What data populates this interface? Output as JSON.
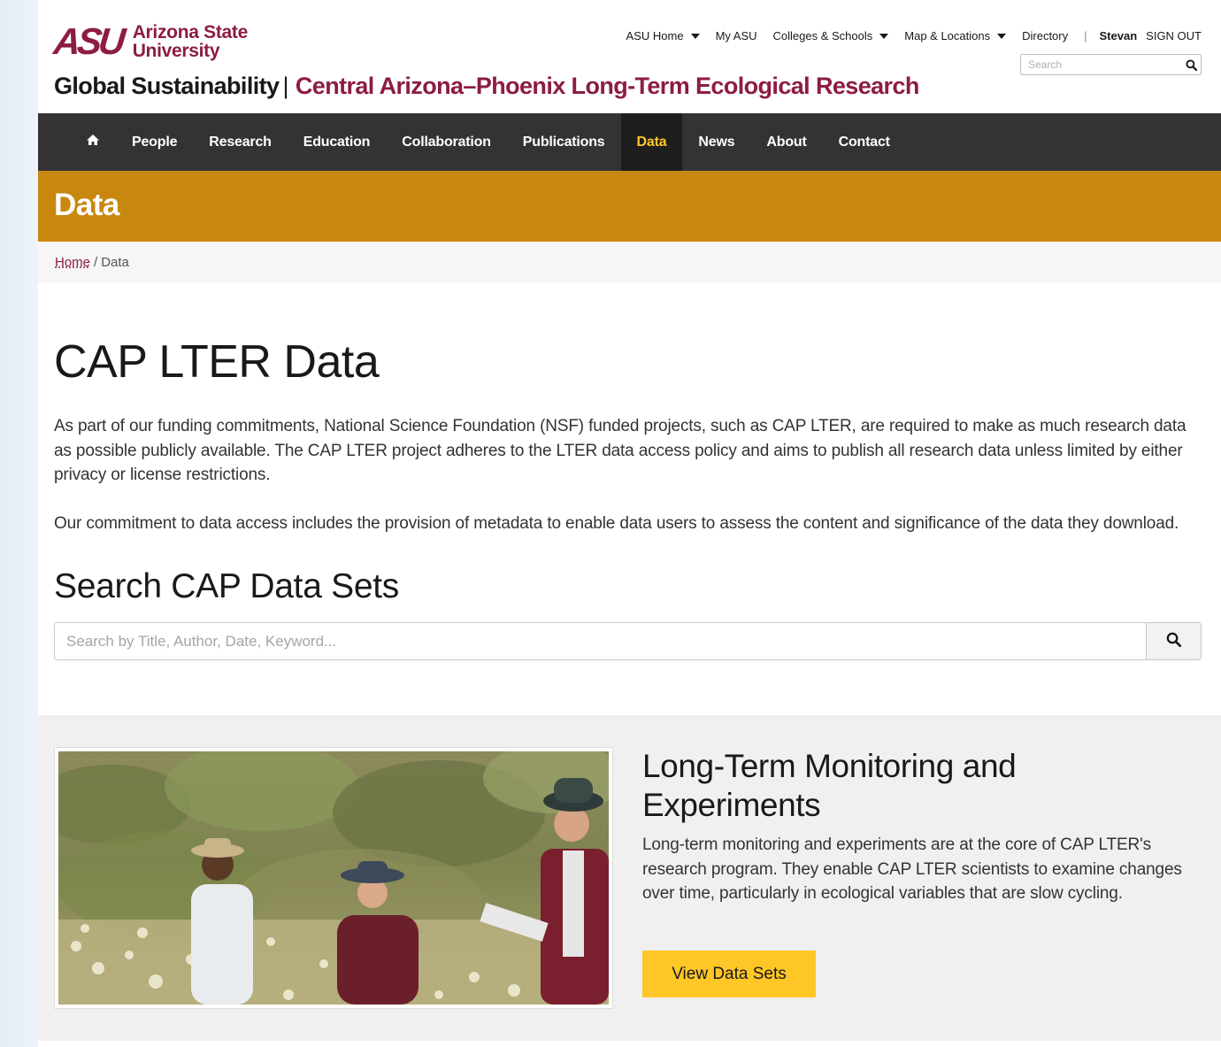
{
  "header": {
    "logo_mark": "ASU",
    "logo_line1": "Arizona State",
    "logo_line2": "University",
    "site_title_primary": "Global Sustainability",
    "site_title_separator": "|",
    "site_title_secondary": "Central Arizona–Phoenix Long-Term Ecological Research",
    "universal_nav": {
      "asu_home": "ASU Home",
      "my_asu": "My ASU",
      "colleges": "Colleges & Schools",
      "map": "Map & Locations",
      "directory": "Directory",
      "divider": "|",
      "user": "Stevan",
      "sign_out": "SIGN OUT"
    },
    "search_placeholder": "Search"
  },
  "nav": {
    "items": [
      {
        "label": "People"
      },
      {
        "label": "Research"
      },
      {
        "label": "Education"
      },
      {
        "label": "Collaboration"
      },
      {
        "label": "Publications"
      },
      {
        "label": "Data"
      },
      {
        "label": "News"
      },
      {
        "label": "About"
      },
      {
        "label": "Contact"
      }
    ],
    "active": "Data"
  },
  "banner": {
    "title": "Data"
  },
  "breadcrumb": {
    "home": "Home",
    "separator": "/",
    "current": "Data"
  },
  "main": {
    "title": "CAP LTER Data",
    "paragraph1": "As part of our funding commitments, National Science Foundation (NSF) funded projects, such as CAP LTER, are required to make as much research data as possible publicly available. The CAP LTER project adheres to the LTER data access policy and aims to publish all research data unless limited by either privacy or license restrictions.",
    "paragraph2": "Our commitment to data access includes the provision of metadata to enable data users to assess the content and significance of the data they download.",
    "search_title": "Search CAP Data Sets",
    "search_placeholder": "Search by Title, Author, Date, Keyword..."
  },
  "feature": {
    "title": "Long-Term Monitoring and Experiments",
    "text": "Long-term monitoring and experiments are at the core of CAP LTER's research program. They enable CAP LTER scientists to examine changes over time, particularly in ecological variables that are slow cycling.",
    "button": "View Data Sets"
  },
  "colors": {
    "asu_maroon": "#8c1d40",
    "asu_gold": "#ffc627",
    "banner_gold": "#c8870f",
    "nav_dark": "#333333"
  },
  "icons": [
    "home-icon",
    "search-icon",
    "caret-down-icon"
  ]
}
